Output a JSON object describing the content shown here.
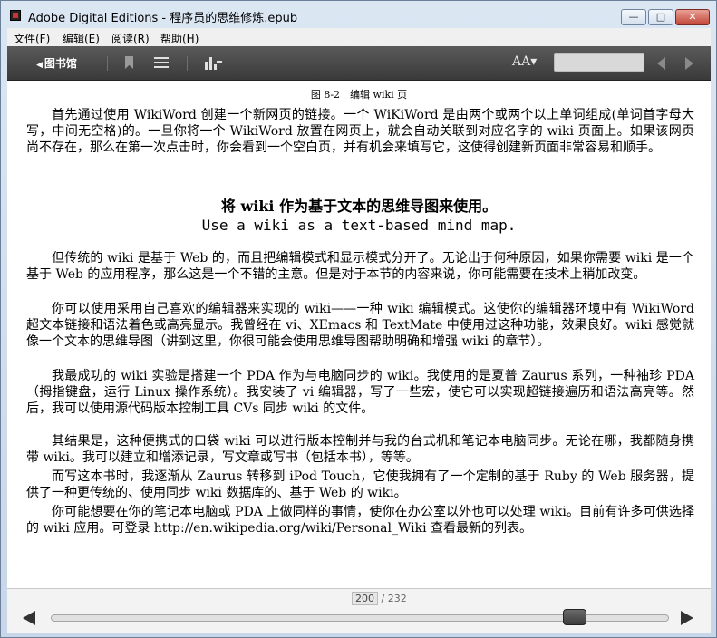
{
  "window": {
    "title": "Adobe Digital Editions - 程序员的思维修炼.epub",
    "minimize": "—",
    "maximize": "□",
    "close": "✕"
  },
  "menu": [
    "文件(F)",
    "编辑(E)",
    "阅读(R)",
    "帮助(H)"
  ],
  "toolbar": {
    "library_arrow": "◀",
    "library_label": "图书馆",
    "font_size_label": "AA▾",
    "icons": [
      "bookmark-icon",
      "list-icon",
      "chart-icon",
      "search-field",
      "prev-arrow-icon",
      "next-arrow-icon"
    ]
  },
  "content": {
    "figure_caption": "图 8-2　编辑 wiki 页",
    "paragraphs": [
      "首先通过使用 WikiWord 创建一个新网页的链接。一个 WiKiWord 是由两个或两个以上单词组成(单词首字母大写，中间无空格)的。一旦你将一个 WikiWord 放置在网页上，就会自动关联到对应名字的 wiki 页面上。如果该网页尚不存在，那么在第一次点击时，你会看到一个空白页，并有机会来填写它，这使得创建新页面非常容易和顺手。",
      "但传统的 wiki 是基于 Web 的，而且把编辑模式和显示模式分开了。无论出于何种原因，如果你需要 wiki 是一个基于 Web 的应用程序，那么这是一个不错的主意。但是对于本节的内容来说，你可能需要在技术上稍加改变。",
      "你可以使用采用自己喜欢的编辑器来实现的 wiki——一种 wiki 编辑模式。这使你的编辑器环境中有 WikiWord 超文本链接和语法着色或高亮显示。我曾经在 vi、XEmacs 和 TextMate 中使用过这种功能，效果良好。wiki 感觉就像一个文本的思维导图（讲到这里，你很可能会使用思维导图帮助明确和增强 wiki 的章节）。",
      "我最成功的 wiki 实验是搭建一个 PDA 作为与电脑同步的 wiki。我使用的是夏普 Zaurus 系列，一种袖珍 PDA（拇指键盘，运行 Linux 操作系统）。我安装了 vi 编辑器，写了一些宏，使它可以实现超链接遍历和语法高亮等。然后，我可以使用源代码版本控制工具 CVs 同步 wiki 的文件。",
      "其结果是，这种便携式的口袋 wiki 可以进行版本控制并与我的台式机和笔记本电脑同步。无论在哪，我都随身携带 wiki。我可以建立和增添记录，写文章或写书（包括本书），等等。",
      "而写这本书时，我逐渐从 Zaurus 转移到 iPod Touch，它使我拥有了一个定制的基于 Ruby 的 Web 服务器，提供了一种更传统的、使用同步 wiki 数据库的、基于 Web 的 wiki。",
      "你可能想要在你的笔记本电脑或 PDA 上做同样的事情，使你在办公室以外也可以处理 wiki。目前有许多可供选择的 wiki 应用。可登录 http://en.wikipedia.org/wiki/Personal_Wiki 查看最新的列表。"
    ],
    "quote_cn": "将 wiki 作为基于文本的思维导图来使用。",
    "quote_en": "Use a wiki as a text-based mind map."
  },
  "pagination": {
    "current": "200",
    "separator": " / ",
    "total": "232",
    "progress_fraction": 0.862
  }
}
